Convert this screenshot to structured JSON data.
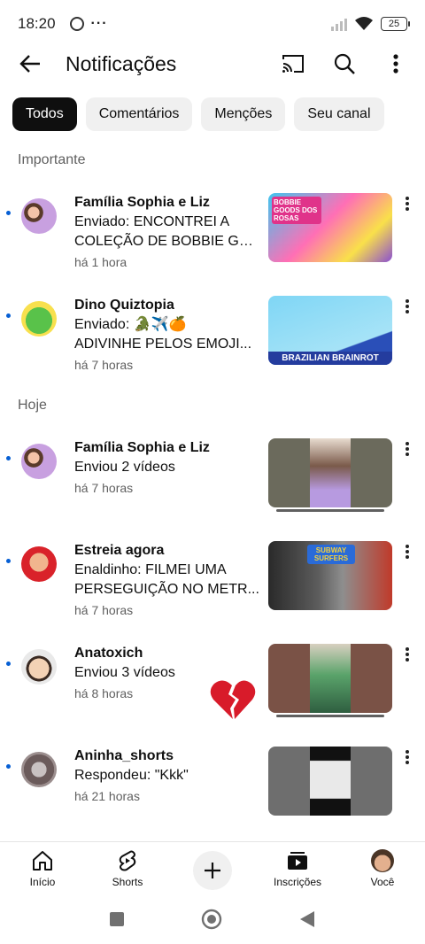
{
  "status_bar": {
    "time": "18:20",
    "battery": "25"
  },
  "header": {
    "title": "Notificações"
  },
  "chips": [
    {
      "label": "Todos"
    },
    {
      "label": "Comentários"
    },
    {
      "label": "Menções"
    },
    {
      "label": "Seu canal"
    }
  ],
  "sections": {
    "important": "Importante",
    "today": "Hoje"
  },
  "notifications": [
    {
      "name": "Família Sophia e Liz",
      "message": "Enviado: ENCONTREI A COLEÇÃO DE BOBBIE GO...",
      "message_line1": "Enviado: ENCONTREI A",
      "message_line2": "COLEÇÃO DE BOBBIE GO...",
      "time": "há 1 hora",
      "thumb_text": "BOBBIE GOODS DOS ROSAS"
    },
    {
      "name": "Dino Quiztopia",
      "message_line1": "Enviado: 🐊✈️🍊",
      "message_line2": "ADIVINHE PELOS EMOJI...",
      "time": "há 7 horas",
      "thumb_text": "BRAZILIAN BRAINROT"
    },
    {
      "name": "Família Sophia e Liz",
      "message_line1": "Enviou 2 vídeos",
      "time": "há 7 horas"
    },
    {
      "name": "Estreia agora",
      "message_line1": "Enaldinho: FILMEI UMA",
      "message_line2": "PERSEGUIÇÃO NO METR...",
      "time": "há 7 horas",
      "thumb_text": "SUBWAY SURFERS"
    },
    {
      "name": "Anatoxich",
      "message_line1": "Enviou 3 vídeos",
      "time": "há 8 horas"
    },
    {
      "name": "Aninha_shorts",
      "message_line1": "Respondeu: \"Kkk\"",
      "time": "há 21 horas"
    }
  ],
  "bottom_nav": [
    {
      "label": "Início",
      "icon": "home-icon"
    },
    {
      "label": "Shorts",
      "icon": "shorts-icon"
    },
    {
      "label": "",
      "icon": "plus-icon"
    },
    {
      "label": "Inscrições",
      "icon": "subscriptions-icon"
    },
    {
      "label": "Você",
      "icon": "avatar"
    }
  ],
  "colors": {
    "accent_dot": "#065fd4",
    "chip_active": "#0f0f0f",
    "chip": "#f0f0f0"
  }
}
